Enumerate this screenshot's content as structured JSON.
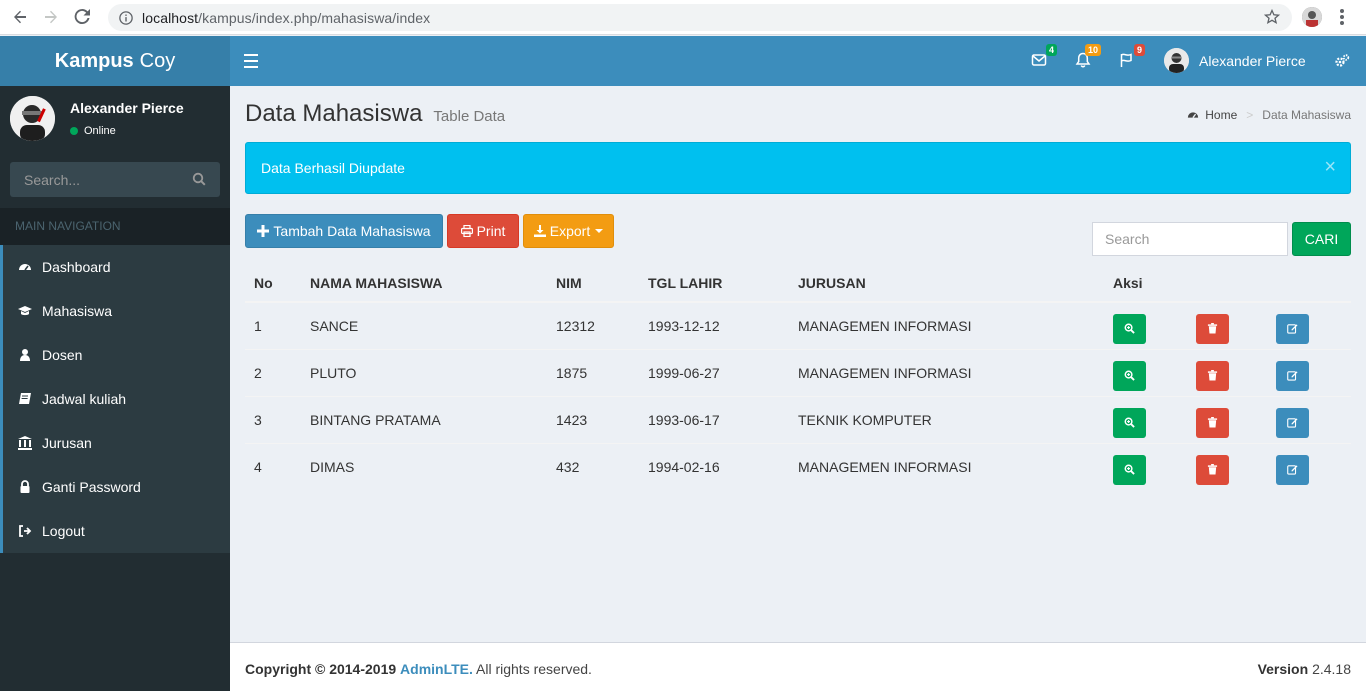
{
  "browser": {
    "url_host": "localhost",
    "url_path": "/kampus/index.php/mahasiswa/index"
  },
  "header": {
    "logo_bold": "Kampus",
    "logo_light": "Coy",
    "messages_count": "4",
    "notifications_count": "10",
    "tasks_count": "9",
    "user_name": "Alexander Pierce"
  },
  "sidebar": {
    "user_name": "Alexander Pierce",
    "status": "Online",
    "search_placeholder": "Search...",
    "nav_header": "MAIN NAVIGATION",
    "items": [
      {
        "label": "Dashboard",
        "icon": "dashboard-icon"
      },
      {
        "label": "Mahasiswa",
        "icon": "graduation-cap-icon"
      },
      {
        "label": "Dosen",
        "icon": "user-icon"
      },
      {
        "label": "Jadwal kuliah",
        "icon": "book-icon"
      },
      {
        "label": "Jurusan",
        "icon": "institution-icon"
      },
      {
        "label": "Ganti Password",
        "icon": "lock-icon"
      },
      {
        "label": "Logout",
        "icon": "sign-out-icon"
      }
    ]
  },
  "content": {
    "title": "Data Mahasiswa",
    "subtitle": "Table Data",
    "breadcrumb_home": "Home",
    "breadcrumb_current": "Data Mahasiswa",
    "alert": "Data Berhasil Diupdate",
    "alert_close": "×",
    "add_button": "Tambah Data Mahasiswa",
    "print_button": "Print",
    "export_button": "Export",
    "search_placeholder": "Search",
    "search_button": "CARI"
  },
  "table": {
    "headers": [
      "No",
      "NAMA MAHASISWA",
      "NIM",
      "TGL LAHIR",
      "JURUSAN",
      "Aksi"
    ],
    "rows": [
      {
        "no": "1",
        "nama": "SANCE",
        "nim": "12312",
        "tgl": "1993-12-12",
        "jurusan": "MANAGEMEN INFORMASI"
      },
      {
        "no": "2",
        "nama": "PLUTO",
        "nim": "1875",
        "tgl": "1999-06-27",
        "jurusan": "MANAGEMEN INFORMASI"
      },
      {
        "no": "3",
        "nama": "BINTANG PRATAMA",
        "nim": "1423",
        "tgl": "1993-06-17",
        "jurusan": "TEKNIK KOMPUTER"
      },
      {
        "no": "4",
        "nama": "DIMAS",
        "nim": "432",
        "tgl": "1994-02-16",
        "jurusan": "MANAGEMEN INFORMASI"
      }
    ]
  },
  "footer": {
    "copyright": "Copyright © 2014-2019",
    "brand": "AdminLTE.",
    "rights": "All rights reserved.",
    "version_label": "Version",
    "version": "2.4.18"
  },
  "colors": {
    "primary": "#3c8dbc",
    "sidebar": "#222d32",
    "info": "#00c0ef",
    "success": "#00a65a",
    "danger": "#dd4b39",
    "warning": "#f39c12"
  }
}
